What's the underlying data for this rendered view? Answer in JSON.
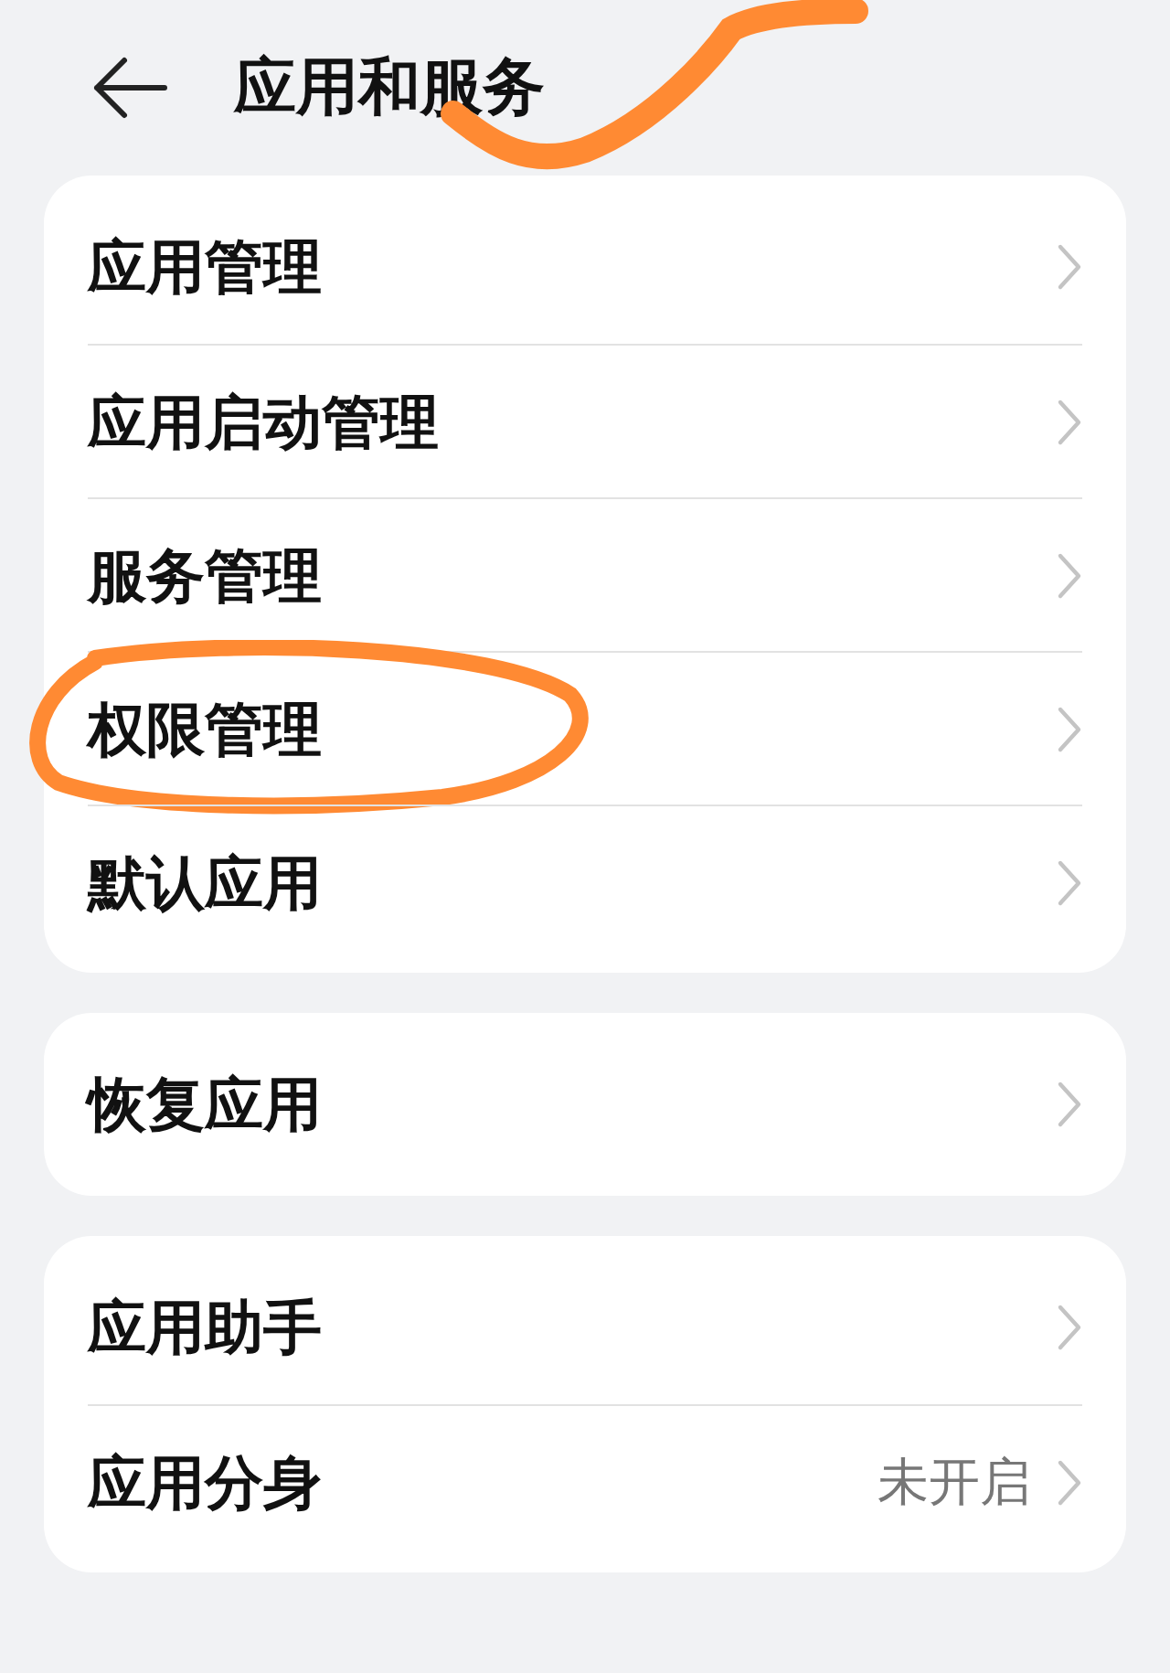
{
  "header": {
    "title": "应用和服务"
  },
  "groups": [
    {
      "items": [
        {
          "label": "应用管理",
          "circled": false
        },
        {
          "label": "应用启动管理",
          "circled": false
        },
        {
          "label": "服务管理",
          "circled": false
        },
        {
          "label": "权限管理",
          "circled": true
        },
        {
          "label": "默认应用",
          "circled": false
        }
      ]
    },
    {
      "items": [
        {
          "label": "恢复应用",
          "circled": false
        }
      ]
    },
    {
      "items": [
        {
          "label": "应用助手",
          "circled": false
        },
        {
          "label": "应用分身",
          "value": "未开启",
          "circled": false
        }
      ]
    }
  ]
}
